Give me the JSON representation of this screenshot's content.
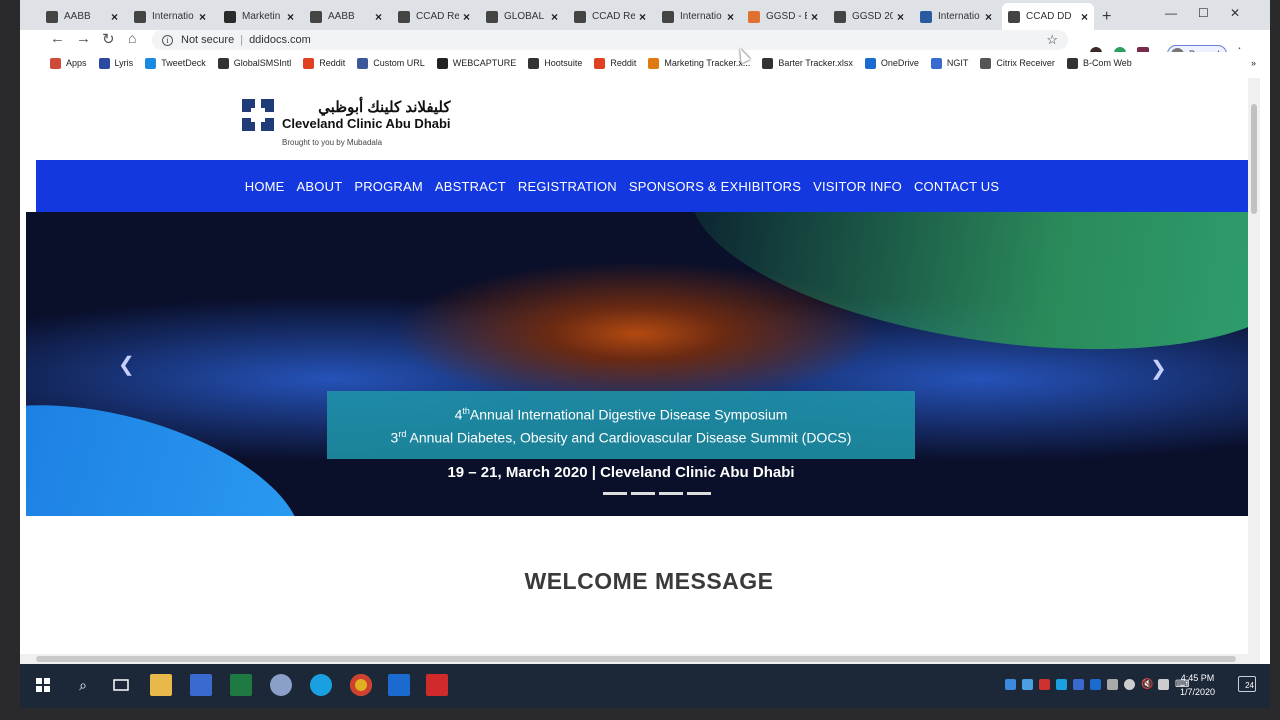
{
  "tabs": [
    {
      "title": "AABB",
      "icon": "document-icon",
      "color": "#444444"
    },
    {
      "title": "Internatio",
      "icon": "send-icon",
      "color": "#444444"
    },
    {
      "title": "Marketin",
      "icon": "spreadsheet-icon",
      "color": "#2a2a2a"
    },
    {
      "title": "AABB",
      "icon": "document-icon",
      "color": "#444444"
    },
    {
      "title": "CCAD Re",
      "icon": "globe-icon",
      "color": "#444444"
    },
    {
      "title": "GLOBAL I",
      "icon": "globe-icon",
      "color": "#444444"
    },
    {
      "title": "CCAD Re",
      "icon": "globe-icon",
      "color": "#444444"
    },
    {
      "title": "Internatio",
      "icon": "send-icon",
      "color": "#444444"
    },
    {
      "title": "GGSD - E",
      "icon": "form-icon",
      "color": "#e07030"
    },
    {
      "title": "GGSD 20",
      "icon": "globe-icon",
      "color": "#444444"
    },
    {
      "title": "Internatio",
      "icon": "linkedin-icon",
      "color": "#2a5aa0"
    },
    {
      "title": "CCAD DD",
      "icon": "globe-icon",
      "color": "#444444",
      "active": true
    }
  ],
  "toolbar": {
    "security": "Not secure",
    "url": "ddidocs.com",
    "profile_status": "Paused"
  },
  "bookmarks": [
    {
      "label": "Apps",
      "color": "#d04a3a"
    },
    {
      "label": "Lyris",
      "color": "#2a4aa0"
    },
    {
      "label": "TweetDeck",
      "color": "#1a8ae0"
    },
    {
      "label": "GlobalSMSIntl",
      "color": "#333333"
    },
    {
      "label": "Reddit",
      "color": "#e04020"
    },
    {
      "label": "Custom URL",
      "color": "#3b5998"
    },
    {
      "label": "WEBCAPTURE",
      "color": "#222222"
    },
    {
      "label": "Hootsuite",
      "color": "#333333"
    },
    {
      "label": "Reddit",
      "color": "#e04020"
    },
    {
      "label": "Marketing Tracker.x...",
      "color": "#e07a10"
    },
    {
      "label": "Barter Tracker.xlsx",
      "color": "#333333"
    },
    {
      "label": "OneDrive",
      "color": "#1a6ad0"
    },
    {
      "label": "NGIT",
      "color": "#3a6ad0"
    },
    {
      "label": "Citrix Receiver",
      "color": "#555555"
    },
    {
      "label": "B-Com Web",
      "color": "#333333"
    }
  ],
  "site": {
    "logo_arabic": "كليفلاند كلينك أبوظبي",
    "logo_english": "Cleveland Clinic Abu Dhabi",
    "tagline": "Brought to you by Mubadala",
    "nav": [
      "HOME",
      "ABOUT",
      "PROGRAM",
      "ABSTRACT",
      "REGISTRATION",
      "SPONSORS & EXHIBITORS",
      "VISITOR INFO",
      "CONTACT US"
    ],
    "banner": {
      "line1_num": "4",
      "line1_sup": "th",
      "line1_text": "Annual International Digestive Disease Symposium",
      "line2_num": "3",
      "line2_sup": "rd",
      "line2_text": " Annual Diabetes, Obesity and Cardiovascular Disease Summit (DOCS)"
    },
    "dates": "19 – 21, March 2020 | Cleveland Clinic Abu Dhabi",
    "welcome": "WELCOME MESSAGE"
  },
  "taskbar": {
    "time": "4:45 PM",
    "date": "1/7/2020",
    "notification_count": "24"
  }
}
